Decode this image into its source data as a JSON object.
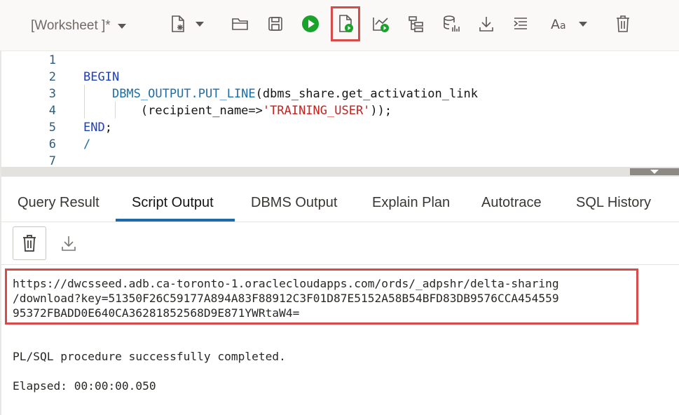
{
  "toolbar": {
    "worksheet_label": "[Worksheet ]*",
    "icons": [
      "new-file-icon",
      "open-folder-icon",
      "save-icon",
      "run-statement-icon",
      "run-script-icon",
      "explain-plan-icon",
      "autotrace-icon",
      "sql-tuning-icon",
      "download-icon",
      "format-icon",
      "font-size-icon",
      "clear-icon"
    ],
    "accent_run": "#1aa32b",
    "highlight_color": "#d94a4a"
  },
  "editor": {
    "line_numbers": [
      "1",
      "2",
      "3",
      "4",
      "5",
      "6",
      "7"
    ],
    "line2_kw": "BEGIN",
    "line3_fn": "DBMS_OUTPUT.PUT_LINE",
    "line3_rest": "(dbms_share.get_activation_link",
    "line4_pre": "(recipient_name=>",
    "line4_str": "'TRAINING_USER'",
    "line4_post": "));",
    "line5_kw": "END",
    "line5_post": ";",
    "line6": "/"
  },
  "tabs": [
    {
      "label": "Query Result"
    },
    {
      "label": "Script Output"
    },
    {
      "label": "DBMS Output"
    },
    {
      "label": "Explain Plan"
    },
    {
      "label": "Autotrace"
    },
    {
      "label": "SQL History"
    }
  ],
  "active_tab": "Script Output",
  "output": {
    "url_line1": "https://dwcsseed.adb.ca-toronto-1.oraclecloudapps.com/ords/_adpshr/delta-sharing",
    "url_line2": "/download?key=51350F26C59177A894A83F88912C3F01D87E5152A58B54BFD83DB9576CCA454559",
    "url_line3": "95372FBADD0E640CA36281852568D9E871YWRtaW4=",
    "status": "PL/SQL procedure successfully completed.",
    "elapsed": "Elapsed: 00:00:00.050"
  }
}
